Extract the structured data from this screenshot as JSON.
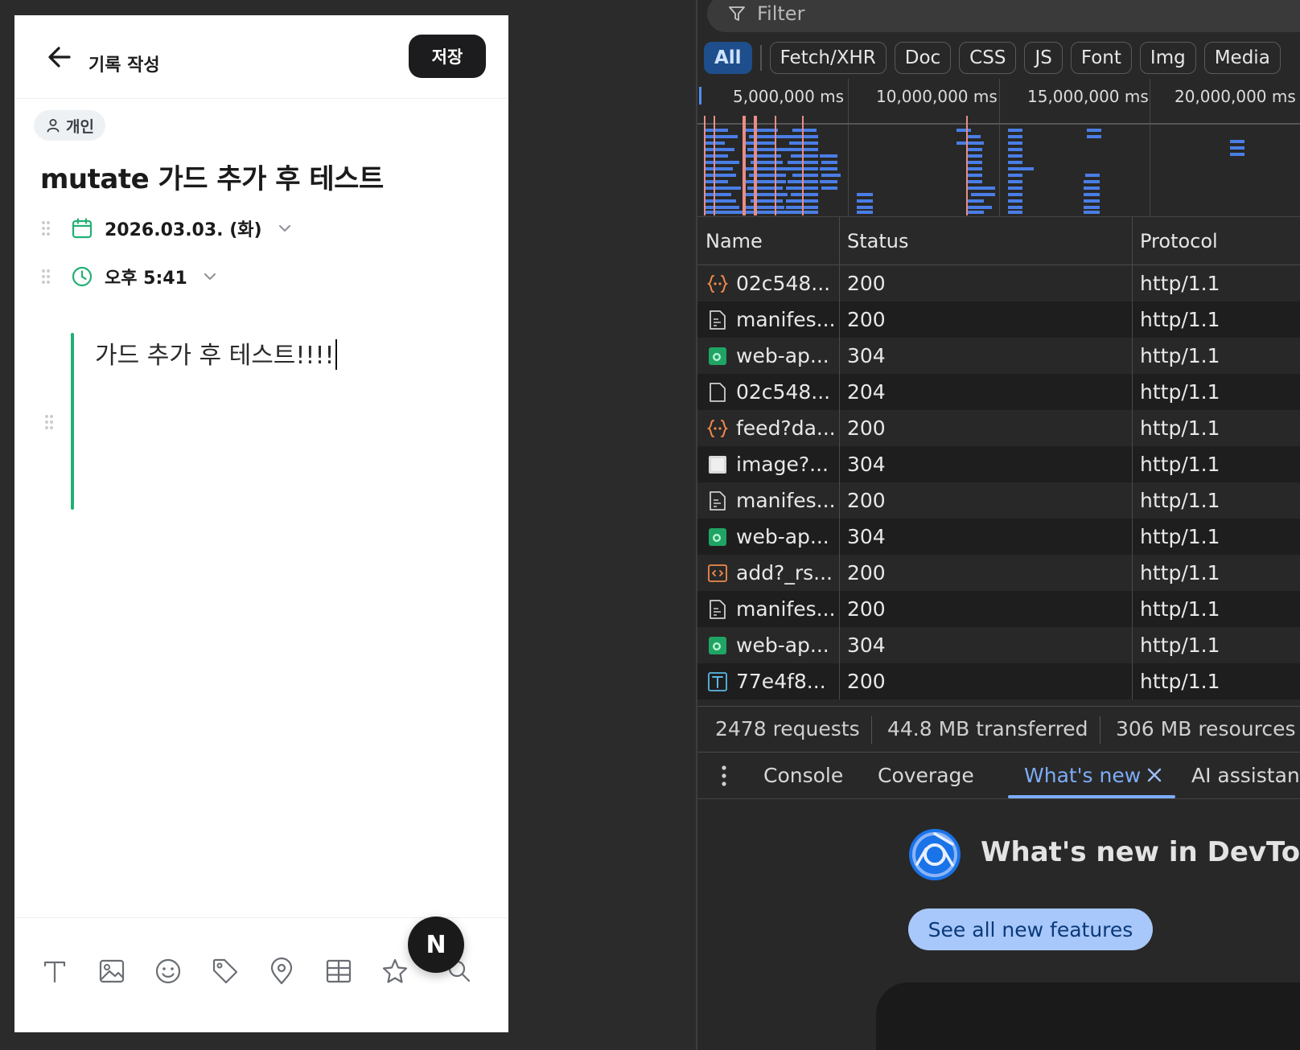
{
  "app": {
    "header_title": "기록 작성",
    "save_label": "저장",
    "chip_label": "개인",
    "doc_title": "mutate 가드 추가 후 테스트",
    "date": "2026.03.03. (화)",
    "time": "오후 5:41",
    "body_text": "가드 추가 후 테스트!!!!",
    "fab_label": "N",
    "accent_color": "#22b073",
    "toolbar_icons": [
      "text-icon",
      "image-icon",
      "emoji-icon",
      "tag-icon",
      "location-pin-icon",
      "table-icon",
      "star-icon",
      "search-icon"
    ]
  },
  "devtools": {
    "filter_placeholder": "Filter",
    "type_filters": [
      "All",
      "Fetch/XHR",
      "Doc",
      "CSS",
      "JS",
      "Font",
      "Img",
      "Media"
    ],
    "active_filter": "All",
    "timeline_labels": [
      "5,000,000 ms",
      "10,000,000 ms",
      "15,000,000 ms",
      "20,000,000 ms"
    ],
    "columns": [
      "Name",
      "Status",
      "Protocol"
    ],
    "rows": [
      {
        "name": "02c548...",
        "status": "200",
        "protocol": "http/1.1",
        "icon": "fetch-icon"
      },
      {
        "name": "manifes...",
        "status": "200",
        "protocol": "http/1.1",
        "icon": "document-icon"
      },
      {
        "name": "web-ap...",
        "status": "304",
        "protocol": "http/1.1",
        "icon": "image-icon"
      },
      {
        "name": "02c548...",
        "status": "204",
        "protocol": "http/1.1",
        "icon": "blank-file-icon"
      },
      {
        "name": "feed?da...",
        "status": "200",
        "protocol": "http/1.1",
        "icon": "fetch-icon"
      },
      {
        "name": "image?...",
        "status": "304",
        "protocol": "http/1.1",
        "icon": "thumbnail-icon"
      },
      {
        "name": "manifes...",
        "status": "200",
        "protocol": "http/1.1",
        "icon": "document-icon"
      },
      {
        "name": "web-ap...",
        "status": "304",
        "protocol": "http/1.1",
        "icon": "image-icon"
      },
      {
        "name": "add?_rs...",
        "status": "200",
        "protocol": "http/1.1",
        "icon": "script-icon"
      },
      {
        "name": "manifes...",
        "status": "200",
        "protocol": "http/1.1",
        "icon": "document-icon"
      },
      {
        "name": "web-ap...",
        "status": "304",
        "protocol": "http/1.1",
        "icon": "image-icon"
      },
      {
        "name": "77e4f8...",
        "status": "200",
        "protocol": "http/1.1",
        "icon": "font-icon"
      }
    ],
    "summary": {
      "requests": "2478 requests",
      "transferred": "44.8 MB transferred",
      "resources": "306 MB resources"
    },
    "drawer_tabs": [
      "Console",
      "Coverage",
      "What's new",
      "AI assistance"
    ],
    "active_drawer_tab": "What's new",
    "whats_new_title": "What's new in DevTools",
    "see_all_label": "See all new features"
  }
}
